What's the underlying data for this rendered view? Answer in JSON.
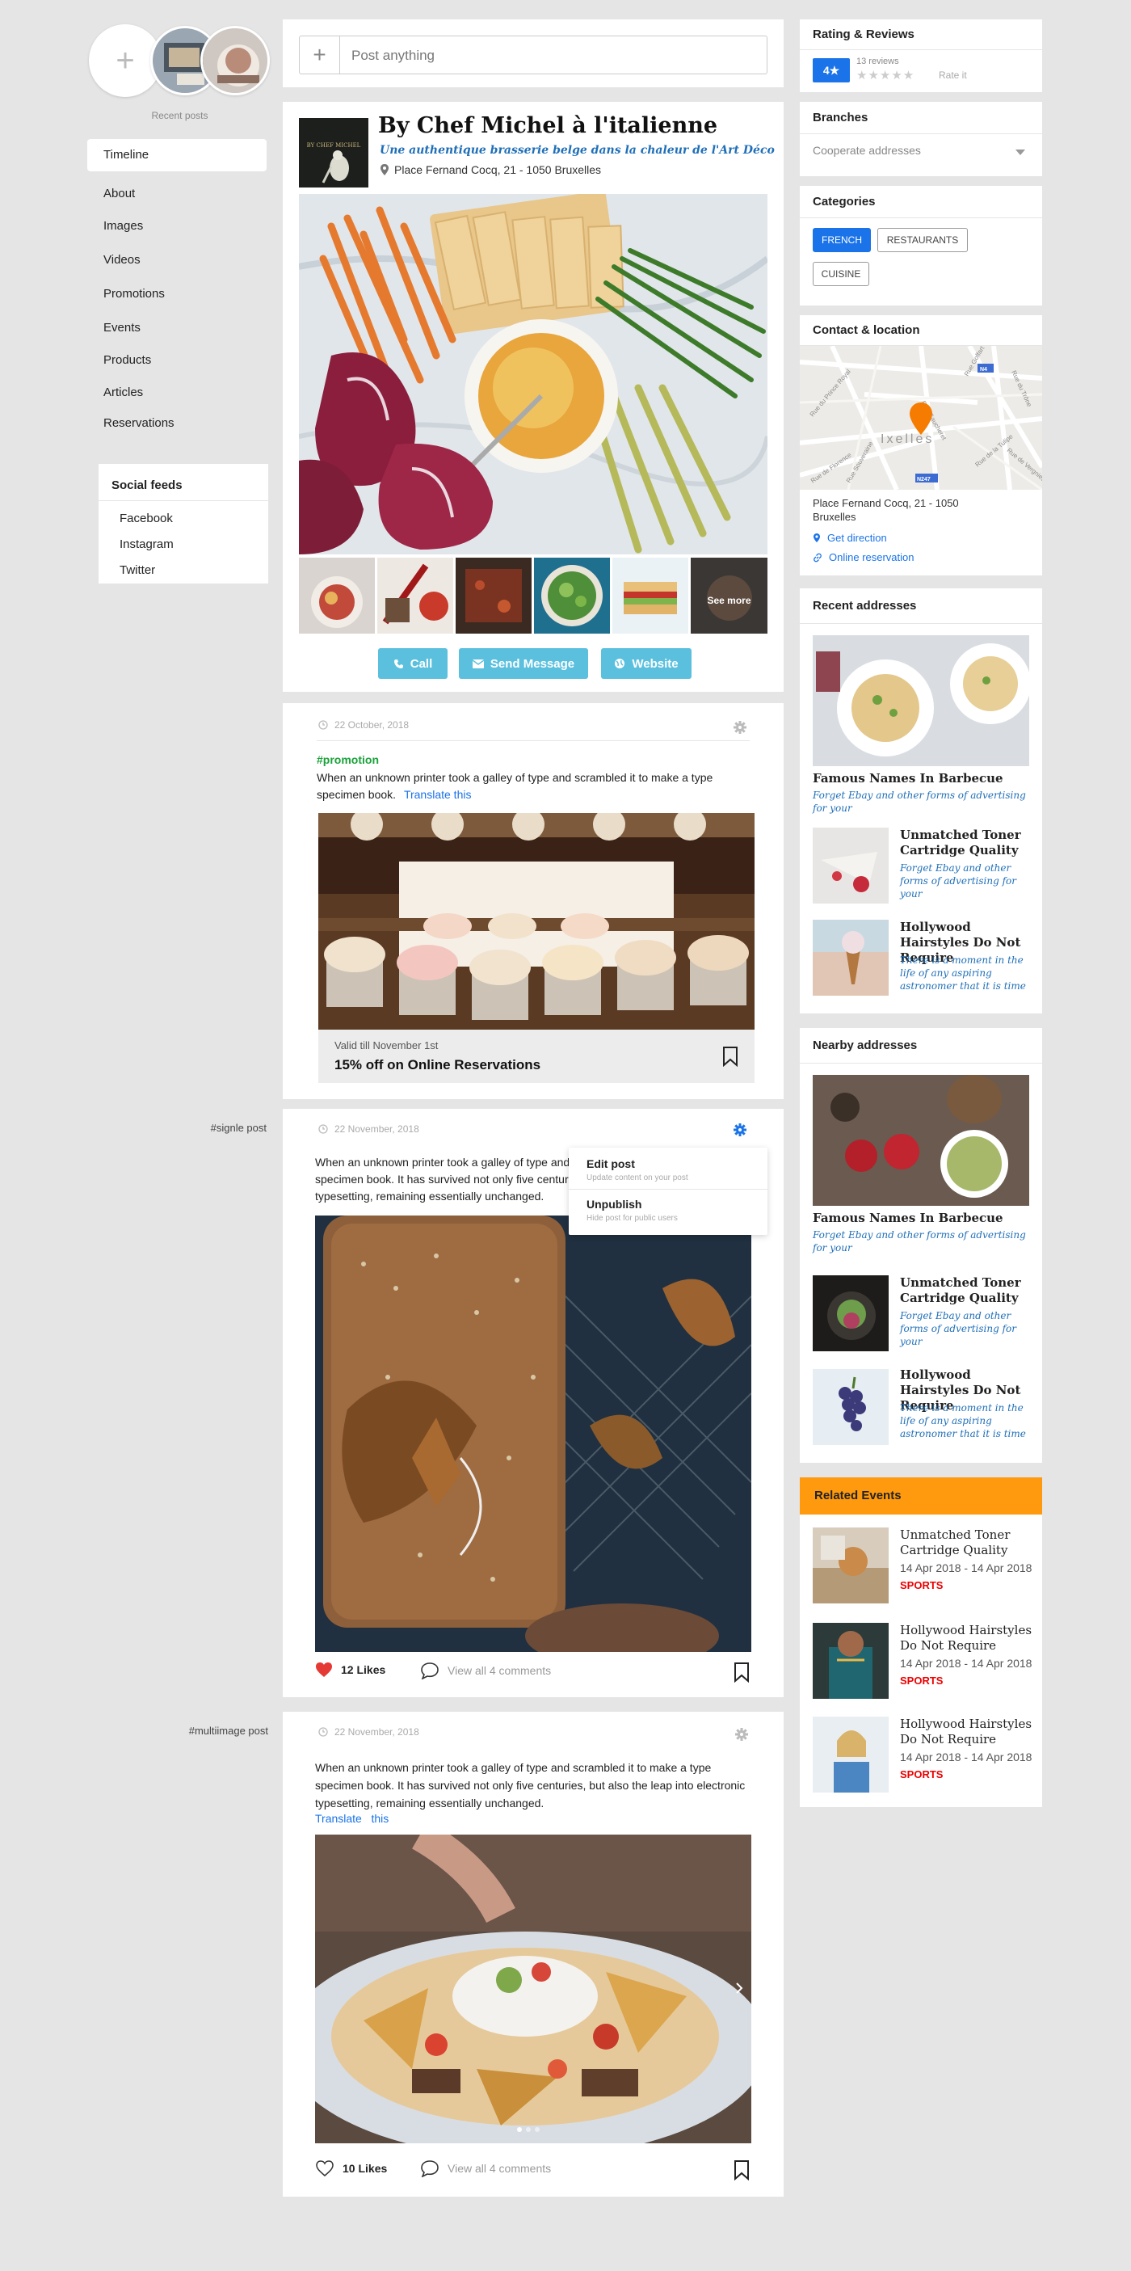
{
  "left": {
    "recent_posts_label": "Recent posts",
    "nav": [
      "Timeline",
      "About",
      "Images",
      "Videos",
      "Promotions",
      "Events",
      "Products",
      "Articles",
      "Reservations"
    ],
    "social_title": "Social feeds",
    "social_items": [
      "Facebook",
      "Instagram",
      "Twitter"
    ],
    "post_tags": [
      "#signle post",
      "#multiimage post"
    ]
  },
  "composer": {
    "placeholder": "Post anything",
    "plus_icon": "plus-icon"
  },
  "profile": {
    "logo_text": "BY CHEF MICHEL",
    "name": "By Chef Michel à l'italienne",
    "tagline": "Une authentique brasserie belge dans la chaleur de l'Art Déco",
    "address": "Place Fernand Cocq, 21 - 1050 Bruxelles",
    "see_more": "See more",
    "buttons": {
      "call": "Call",
      "message": "Send Message",
      "website": "Website"
    }
  },
  "post1": {
    "date": "22 October, 2018",
    "hashtag": "#promotion",
    "text": "When an unknown printer took a galley of type and scrambled it to make a type specimen book.",
    "translate": "Translate this",
    "valid": "Valid till November 1st",
    "offer": "15% off on Online Reservations"
  },
  "post2": {
    "date": "22 November, 2018",
    "text": "When an unknown printer took a galley of type and scrambled it to make a type specimen book. It has survived not only five centuries, but also the leap into electronic typesetting, remaining essentially unchanged.",
    "menu": [
      {
        "title": "Edit post",
        "sub": "Update content on your post"
      },
      {
        "title": "Unpublish",
        "sub": "Hide post for public users"
      }
    ],
    "likes": "12 Likes",
    "comments": "View all 4 comments"
  },
  "post3": {
    "date": "22 November, 2018",
    "text": "When an unknown printer took a galley of type and scrambled it to make a type specimen book. It has survived not only five centuries, but also the leap into electronic typesetting, remaining essentially unchanged.",
    "translate": "Translate   this",
    "likes": "10 Likes",
    "comments": "View all 4 comments"
  },
  "sidebar": {
    "rating_title": "Rating & Reviews",
    "rating_value": "4★",
    "reviews": "13 reviews",
    "rate_it": "Rate it",
    "branches_title": "Branches",
    "branches_select": "Cooperate addresses",
    "categories_title": "Categories",
    "categories": [
      "FRENCH",
      "RESTAURANTS",
      "CUISINE"
    ],
    "contact_title": "Contact & location",
    "map_label": "Ixelles",
    "map_roads": [
      "Rue du Prince Royal",
      "Rue de Florence",
      "Rue Souveraine",
      "Rue Gaucheret",
      "Rue du Trône",
      "Rue Goffart",
      "Rue de la Tulipe",
      "Rue de Vergnies"
    ],
    "map_badges": [
      "N4",
      "N247"
    ],
    "contact_address": "Place Fernand Cocq, 21 - 1050 Bruxelles",
    "get_direction": "Get direction",
    "online_reservation": "Online reservation",
    "recent_title": "Recent addresses",
    "recent": [
      {
        "title": "Famous Names In Barbecue",
        "desc": "Forget Ebay and other forms of advertising for your"
      },
      {
        "title": "Unmatched Toner Cartridge Quality",
        "desc": "Forget Ebay and other forms of advertising for your"
      },
      {
        "title": "Hollywood Hairstyles Do Not Require",
        "desc": "There is a moment in the life of any aspiring astronomer that it is time"
      }
    ],
    "nearby_title": "Nearby addresses",
    "nearby": [
      {
        "title": "Famous Names In Barbecue",
        "desc": "Forget Ebay and other forms of advertising for your"
      },
      {
        "title": "Unmatched Toner Cartridge Quality",
        "desc": "Forget Ebay and other forms of advertising for your"
      },
      {
        "title": "Hollywood Hairstyles Do Not Require",
        "desc": "There is a moment in the life of any aspiring astronomer that it is time"
      }
    ],
    "events_title": "Related Events",
    "events": [
      {
        "title": "Unmatched Toner Cartridge Quality",
        "date": "14 Apr 2018 - 14 Apr 2018",
        "tag": "SPORTS"
      },
      {
        "title": "Hollywood Hairstyles Do Not Require",
        "date": "14 Apr 2018 - 14 Apr 2018",
        "tag": "SPORTS"
      },
      {
        "title": "Hollywood Hairstyles Do Not Require",
        "date": "14 Apr 2018 - 14 Apr 2018",
        "tag": "SPORTS"
      }
    ]
  },
  "colors": {
    "accent": "#1a73e8",
    "button": "#5bc0de",
    "events": "#ff9a0e",
    "promo": "#1aa23a",
    "like": "#e53935"
  }
}
